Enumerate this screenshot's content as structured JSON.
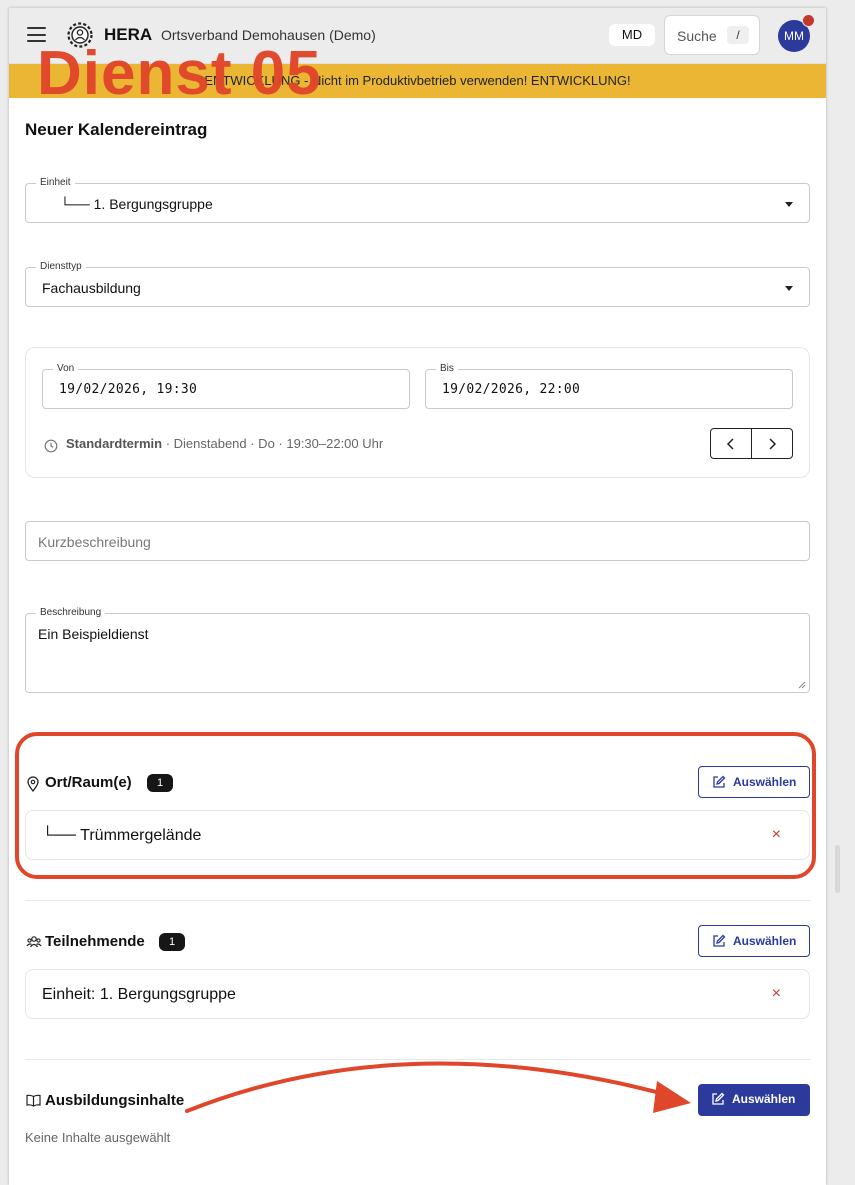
{
  "header": {
    "brand": "HERA",
    "org": "Ortsverband Demohausen (Demo)",
    "md_badge": "MD",
    "search_label": "Suche",
    "search_shortcut": "/",
    "avatar_initials": "MM"
  },
  "overlay_title": "Dienst 05",
  "dev_banner": "ENTWICKLUNG - Nicht im Produktivbetrieb verwenden! ENTWICKLUNG!",
  "page_title": "Neuer Kalendereintrag",
  "form": {
    "einheit": {
      "label": "Einheit",
      "value": "└── 1. Bergungsgruppe"
    },
    "diensttyp": {
      "label": "Diensttyp",
      "value": "Fachausbildung"
    },
    "von": {
      "label": "Von",
      "value": "19/02/2026, 19:30"
    },
    "bis": {
      "label": "Bis",
      "value": "19/02/2026, 22:00"
    },
    "standardtermin": {
      "bold": "Standardtermin",
      "rest": " · Dienstabend · Do · 19:30–22:00 Uhr"
    },
    "kurzbeschreibung": {
      "placeholder": "Kurzbeschreibung"
    },
    "beschreibung": {
      "label": "Beschreibung",
      "value": "Ein Beispieldienst"
    }
  },
  "ort": {
    "title": "Ort/Raum(e)",
    "count": "1",
    "button": "Auswählen",
    "items": [
      {
        "label": "└── Trümmergelände",
        "remove": "×"
      }
    ]
  },
  "teilnehmende": {
    "title": "Teilnehmende",
    "count": "1",
    "button": "Auswählen",
    "items": [
      {
        "label": "Einheit: 1. Bergungsgruppe",
        "remove": "×"
      }
    ]
  },
  "ausbildungsinhalte": {
    "title": "Ausbildungsinhalte",
    "button": "Auswählen",
    "empty_text": "Keine Inhalte ausgewählt"
  },
  "colors": {
    "accent": "#2b3a9b",
    "dev_banner": "#eab634",
    "annotation": "#e0462a",
    "remove": "#c0392b"
  },
  "icons": [
    "menu-icon",
    "thw-logo-icon",
    "clock-icon",
    "chevron-left-icon",
    "chevron-right-icon",
    "map-pin-icon",
    "edit-icon",
    "users-icon",
    "book-icon",
    "close-icon"
  ]
}
